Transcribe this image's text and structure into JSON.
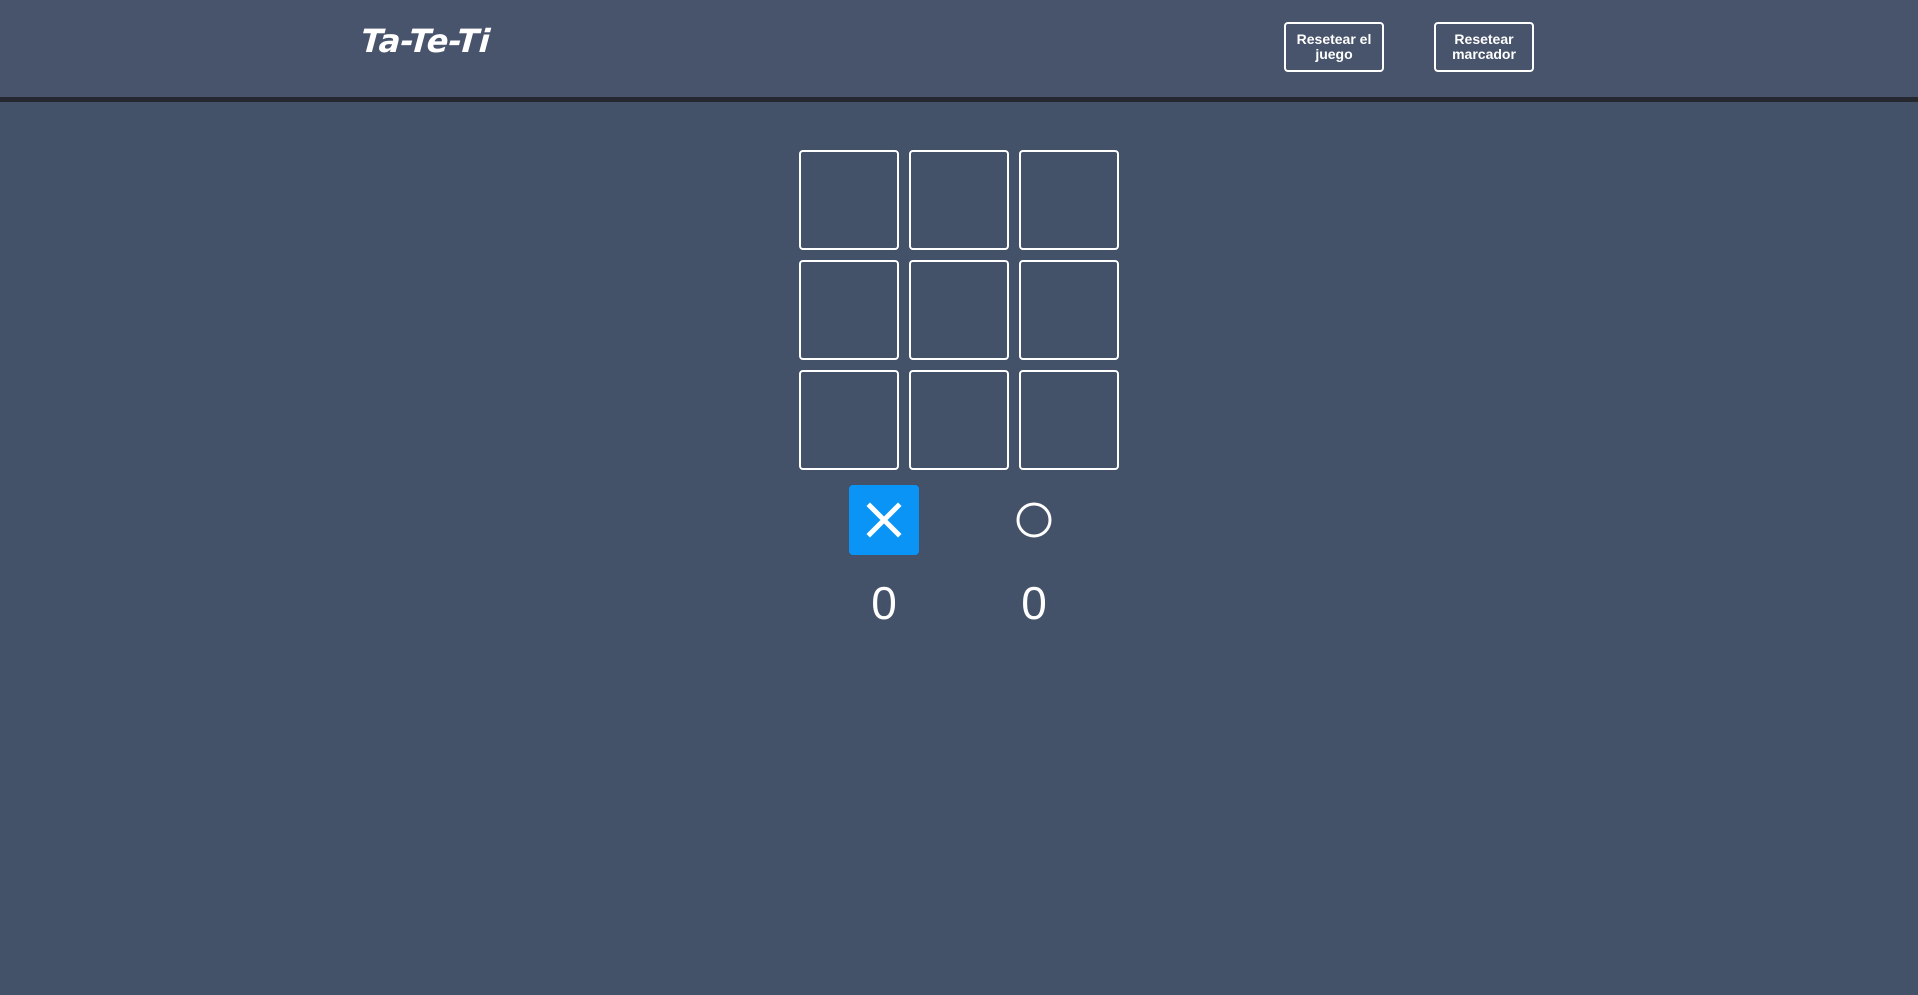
{
  "header": {
    "title": "Ta-Te-Ti",
    "reset_game_label": "Resetear el juego",
    "reset_score_label": "Resetear marcador"
  },
  "board": {
    "cells": [
      "",
      "",
      "",
      "",
      "",
      "",
      "",
      "",
      ""
    ]
  },
  "players": {
    "active": "x",
    "x": {
      "icon": "x-icon",
      "score": "0"
    },
    "o": {
      "icon": "circle-icon",
      "score": "0"
    }
  },
  "colors": {
    "background": "#435169",
    "header": "#48546b",
    "header_border": "#25282f",
    "active_player": "#0a94f5",
    "foreground": "#ffffff"
  }
}
